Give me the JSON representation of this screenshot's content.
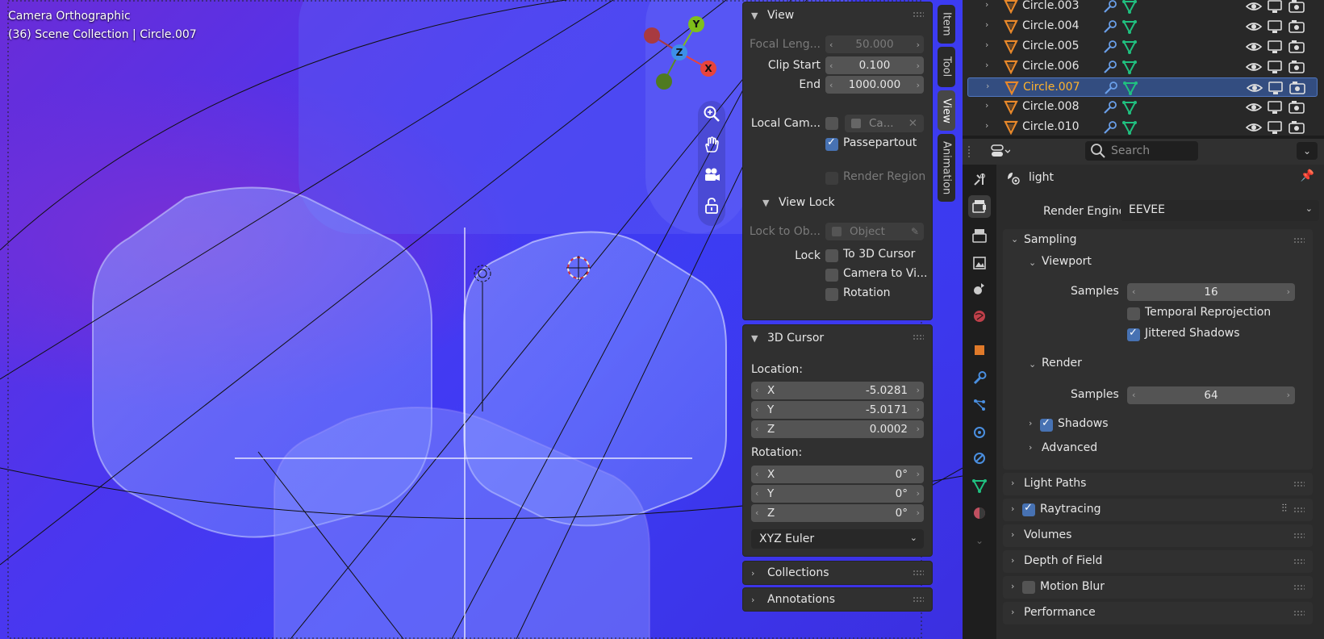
{
  "viewport": {
    "title": "Camera Orthographic",
    "subtitle": "(36) Scene Collection | Circle.007",
    "gizmo": {
      "y": "Y",
      "x": "X",
      "z": "Z"
    }
  },
  "npanel": {
    "tabs": [
      "Item",
      "Tool",
      "View",
      "Animation"
    ],
    "active_tab": "View",
    "view": {
      "header": "View",
      "focal_label": "Focal Leng...",
      "focal_value": "50.000",
      "clip_start_label": "Clip Start",
      "clip_start_value": "0.100",
      "end_label": "End",
      "end_value": "1000.000",
      "local_camera_label": "Local Cam...",
      "local_camera_field": "Ca...",
      "passepartout_label": "Passepartout",
      "render_region_label": "Render Region",
      "view_lock_header": "View Lock",
      "lock_to_obj_label": "Lock to Ob...",
      "lock_to_obj_placeholder": "Object",
      "lock_label": "Lock",
      "to_3d_cursor": "To 3D Cursor",
      "camera_to_view": "Camera to Vi...",
      "rotation": "Rotation"
    },
    "cursor": {
      "header": "3D Cursor",
      "location_label": "Location:",
      "loc_x_label": "X",
      "loc_x": "-5.0281",
      "loc_y_label": "Y",
      "loc_y": "-5.0171",
      "loc_z_label": "Z",
      "loc_z": "0.0002",
      "rotation_label": "Rotation:",
      "rot_x_label": "X",
      "rot_x": "0°",
      "rot_y_label": "Y",
      "rot_y": "0°",
      "rot_z_label": "Z",
      "rot_z": "0°",
      "rotation_mode": "XYZ Euler"
    },
    "collections": "Collections",
    "annotations": "Annotations"
  },
  "outliner": {
    "rows": [
      {
        "name": "Circle.003",
        "selected": false
      },
      {
        "name": "Circle.004",
        "selected": false
      },
      {
        "name": "Circle.005",
        "selected": false
      },
      {
        "name": "Circle.006",
        "selected": false
      },
      {
        "name": "Circle.007",
        "selected": true
      },
      {
        "name": "Circle.008",
        "selected": false
      },
      {
        "name": "Circle.010",
        "selected": false
      }
    ]
  },
  "properties": {
    "search_placeholder": "Search",
    "context_name": "light",
    "render_engine_label": "Render Engine",
    "render_engine_value": "EEVEE",
    "sampling": {
      "header": "Sampling",
      "viewport_header": "Viewport",
      "viewport_samples_label": "Samples",
      "viewport_samples": "16",
      "temporal_reprojection": "Temporal Reprojection",
      "jittered_shadows": "Jittered Shadows",
      "render_header": "Render",
      "render_samples_label": "Samples",
      "render_samples": "64",
      "shadows": "Shadows",
      "advanced": "Advanced"
    },
    "sections": {
      "light_paths": "Light Paths",
      "raytracing": "Raytracing",
      "volumes": "Volumes",
      "depth_of_field": "Depth of Field",
      "motion_blur": "Motion Blur",
      "performance": "Performance"
    },
    "accent_color": "#4772b3",
    "selected_name_color": "#ffb32c"
  }
}
